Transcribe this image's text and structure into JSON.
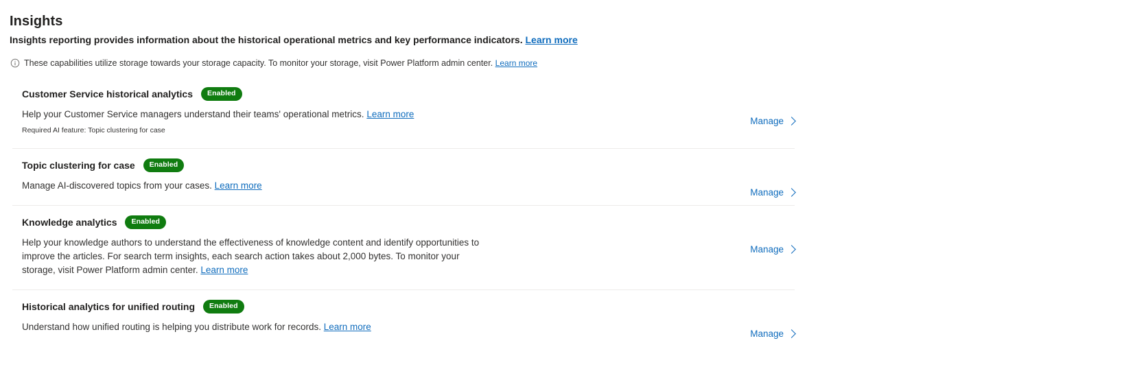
{
  "header": {
    "title": "Insights",
    "subtitle": "Insights reporting provides information about the historical operational metrics and key performance indicators.",
    "subtitle_link": "Learn more"
  },
  "info": {
    "icon": "info-circle-icon",
    "text": "These capabilities utilize storage towards your storage capacity. To monitor your storage, visit Power Platform admin center.",
    "link": "Learn more"
  },
  "colors": {
    "badge_green": "#107c10",
    "link_blue": "#0f6cbd",
    "divider": "#edebe9",
    "text": "#201f1e"
  },
  "manage_label": "Manage",
  "cards": [
    {
      "title": "Customer Service historical analytics",
      "badge": "Enabled",
      "description": "Help your Customer Service managers understand their teams' operational metrics.",
      "description_link": "Learn more",
      "note": "Required AI feature: Topic clustering for case",
      "manage": "Manage"
    },
    {
      "title": "Topic clustering for case",
      "badge": "Enabled",
      "description": "Manage AI-discovered topics from your cases.",
      "description_link": "Learn more",
      "note": "",
      "manage": "Manage"
    },
    {
      "title": "Knowledge analytics",
      "badge": "Enabled",
      "description": "Help your knowledge authors to understand the effectiveness of knowledge content and identify opportunities to improve the articles. For search term insights, each search action takes about 2,000 bytes. To monitor your storage, visit Power Platform admin center.",
      "description_link": "Learn more",
      "note": "",
      "manage": "Manage"
    },
    {
      "title": "Historical analytics for unified routing",
      "badge": "Enabled",
      "description": "Understand how unified routing is helping you distribute work for records.",
      "description_link": "Learn more",
      "note": "",
      "manage": "Manage"
    }
  ]
}
